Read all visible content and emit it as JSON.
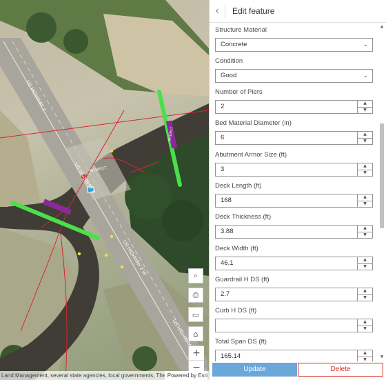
{
  "map": {
    "road_labels": [
      "US HIGHWAY 2",
      "US HIGHWAY 2",
      "US HIGHWAY 2 W",
      "US HIGHWAY 2 W"
    ],
    "feature_labels": [
      "SH19917",
      "SH19917"
    ],
    "tools": {
      "search_icon": "⌕",
      "print_icon": "⎙",
      "basemap_icon": "▭",
      "home_icon": "⌂",
      "zoom_in": "+",
      "zoom_out": "−"
    },
    "attribution": "Land Management, several state agencies, local governments, The Mo...",
    "powered_by": "Powered by Esri"
  },
  "panel": {
    "back_icon": "‹",
    "title": "Edit feature",
    "fields": [
      {
        "label": "Structure Material",
        "value": "Concrete",
        "type": "select"
      },
      {
        "label": "Condition",
        "value": "Good",
        "type": "select"
      },
      {
        "label": "Number of Piers",
        "value": "2",
        "type": "number"
      },
      {
        "label": "Bed Material Diameter (in)",
        "value": "6",
        "type": "number"
      },
      {
        "label": "Abutment Armor Size (ft)",
        "value": "3",
        "type": "number"
      },
      {
        "label": "Deck Length (ft)",
        "value": "168",
        "type": "number"
      },
      {
        "label": "Deck Thickness (ft)",
        "value": "3.88",
        "type": "number"
      },
      {
        "label": "Deck Width (ft)",
        "value": "46.1",
        "type": "number"
      },
      {
        "label": "Guardrail H DS (ft)",
        "value": "2.7",
        "type": "number"
      },
      {
        "label": "Curb H DS (ft)",
        "value": "",
        "type": "number"
      },
      {
        "label": "Total Span DS (ft)",
        "value": "165.14",
        "type": "number"
      }
    ],
    "chevron_icon": "⌄",
    "stepper_up": "▲",
    "stepper_down": "▼",
    "scroll_up": "▲",
    "scroll_down": "▼",
    "update_label": "Update",
    "delete_label": "Delete"
  },
  "colors": {
    "accent_button": "#6ba7d9",
    "delete_red": "#d83020",
    "marker_green": "#4be04b",
    "line_red": "#d9252a",
    "label_purple": "#8a2a9a"
  }
}
